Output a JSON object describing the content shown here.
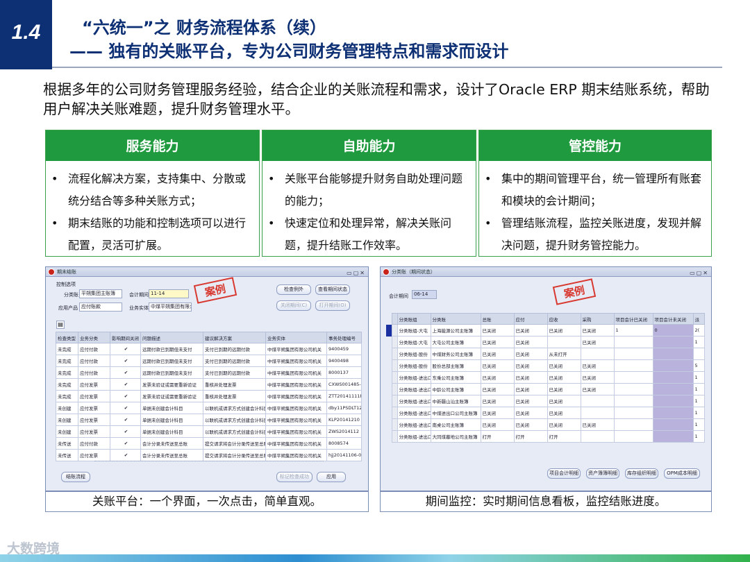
{
  "header": {
    "section_number": "1.4",
    "title_line1": "“六统一”之 财务流程体系（续）",
    "title_line2": "—— 独有的关账平台，专为公司财务管理特点和需求而设计"
  },
  "intro": "根据多年的公司财务管理服务经验，结合企业的关账流程和需求，设计了Oracle ERP 期末结账系统，帮助用户解决关账难题，提升财务管理水平。",
  "columns": [
    {
      "heading": "服务能力",
      "bullets": [
        "流程化解决方案，支持集中、分散或统分结合等多种关账方式；",
        "期末结账的功能和控制选项可以进行配置，灵活可扩展。"
      ]
    },
    {
      "heading": "自助能力",
      "bullets": [
        "关账平台能够提升财务自助处理问题的能力；",
        "快速定位和处理异常，解决关账问题，提升结账工作效率。"
      ]
    },
    {
      "heading": "管控能力",
      "bullets": [
        "集中的期间管理平台，统一管理所有账套和模块的会计期间；",
        "管理结账流程，监控关账进度，发现并解决问题，提升财务管控能力。"
      ]
    }
  ],
  "left_window": {
    "title": "期末结账",
    "stamp": "案例",
    "group_label": "控制选项",
    "fields": {
      "ledger_label": "分类账",
      "ledger_value": "平朔集团主账簿",
      "period_label": "会计期间",
      "period_value": "11-14",
      "product_label": "应用产品",
      "product_value": "应付账款",
      "entity_label": "业务实体",
      "entity_value": "中煤平朔集团有限公司"
    },
    "buttons": {
      "check": "检查例外",
      "status": "查看期间状态",
      "close": "关闭期间(C)",
      "open": "打开期间(O)",
      "flow": "结账流程",
      "mark": "标记检查成功",
      "apply": "应用"
    },
    "columns": [
      "检查类型",
      "业务分类",
      "影响期间关闭",
      "问题描述",
      "建议解决方案",
      "业务实体",
      "事务处理编号"
    ],
    "rows": [
      [
        "未完成",
        "应付付款",
        "✔",
        "远期付款已到期但未支付",
        "支付已到期的远期付款",
        "中煤平朔集团有限公司机关",
        "9400459"
      ],
      [
        "未完成",
        "应付付款",
        "✔",
        "远期付款已到期但未支付",
        "支付已到期的远期付款",
        "中煤平朔集团有限公司机关",
        "9400498"
      ],
      [
        "未完成",
        "应付付款",
        "✔",
        "远期付款已到期但未支付",
        "支付已到期的远期付款",
        "中煤平朔集团有限公司机关",
        "8000137"
      ],
      [
        "未完成",
        "应付发票",
        "✔",
        "发票未验证或需要重新验证",
        "重核并处理发票",
        "中煤平朔集团有限公司机关",
        "CXWS001485-1"
      ],
      [
        "未完成",
        "应付发票",
        "✔",
        "发票未验证或需要重新验证",
        "重核并处理发票",
        "中煤平朔集团有限公司机关",
        "ZTT20141111P"
      ],
      [
        "未创建",
        "应付发票",
        "✔",
        "单据未创建会计科目",
        "以联机或请求方式创建会计科目",
        "中煤平朔集团有限公司机关",
        "dby11PSDLT12"
      ],
      [
        "未创建",
        "应付发票",
        "✔",
        "单据未创建会计科目",
        "以联机或请求方式创建会计科目",
        "中煤平朔集团有限公司机关",
        "KLP20141210"
      ],
      [
        "未创建",
        "应付发票",
        "✔",
        "单据未创建会计科目",
        "以联机或请求方式创建会计科目",
        "中煤平朔集团有限公司机关",
        "ZWS2014112"
      ],
      [
        "未传送",
        "应付付款",
        "✔",
        "会计分录未传送至总账",
        "提交请求将会计分录传送至总账",
        "中煤平朔集团有限公司机关",
        "8008574"
      ],
      [
        "未传送",
        "应付发票",
        "✔",
        "会计分录未传送至总账",
        "提交请求将会计分录传送至总账",
        "中煤平朔集团有限公司机关",
        "hjj20141106-0"
      ]
    ],
    "caption": "关账平台：一个界面，一次点击，简单直观。"
  },
  "right_window": {
    "title": "分类账（期间状态）",
    "stamp": "案例",
    "period_label": "会计期间",
    "period_value": "06-14",
    "columns": [
      "分类账组",
      "分类账",
      "总账",
      "应付",
      "应收",
      "采购",
      "项目会计已关闭",
      "项目会计未关闭",
      "派"
    ],
    "rows": [
      [
        "分类账组-大屯",
        "上海能源公司主账簿",
        "已关闭",
        "已关闭",
        "已关闭",
        "已关闭",
        "1",
        "0",
        "2("
      ],
      [
        "分类账组-大屯",
        "大屯公司主账簿",
        "已关闭",
        "已关闭",
        "",
        "已关闭",
        "",
        "",
        "1"
      ],
      [
        "分类账组-股份",
        "中煤财务公司主账簿",
        "已关闭",
        "已关闭",
        "从未打开",
        "",
        "",
        "",
        ""
      ],
      [
        "分类账组-股份",
        "股份总部主账簿",
        "已关闭",
        "已关闭",
        "已关闭",
        "已关闭",
        "",
        "",
        "5"
      ],
      [
        "分类账组-进出口",
        "东乘公司主账簿",
        "已关闭",
        "已关闭",
        "已关闭",
        "已关闭",
        "",
        "",
        "1"
      ],
      [
        "分类账组-进出口",
        "中龄公司主账簿",
        "已关闭",
        "已关闭",
        "已关闭",
        "已关闭",
        "",
        "",
        "1"
      ],
      [
        "分类账组-进出口",
        "中新疆山汕主账簿",
        "已关闭",
        "已关闭",
        "已关闭",
        "",
        "",
        "",
        "1"
      ],
      [
        "分类账组-进出口",
        "中煤进出口公司主账簿",
        "已关闭",
        "已关闭",
        "已关闭",
        "",
        "",
        "",
        "1"
      ],
      [
        "分类账组-进出口",
        "南桌公司主账簿",
        "已关闭",
        "已关闭",
        "已关闭",
        "已关闭",
        "",
        "",
        "1"
      ],
      [
        "分类账组-进出口",
        "大同煤墓地公司主账簿",
        "打开",
        "打开",
        "打开",
        "",
        "",
        "",
        "1"
      ]
    ],
    "buttons": [
      "项目会计明细",
      "资产簿簿明细",
      "库存组织明细",
      "OPM成本明细"
    ],
    "caption": "期间监控：实时期间信息看板，监控结账进度。"
  },
  "watermark": "大数跨境"
}
